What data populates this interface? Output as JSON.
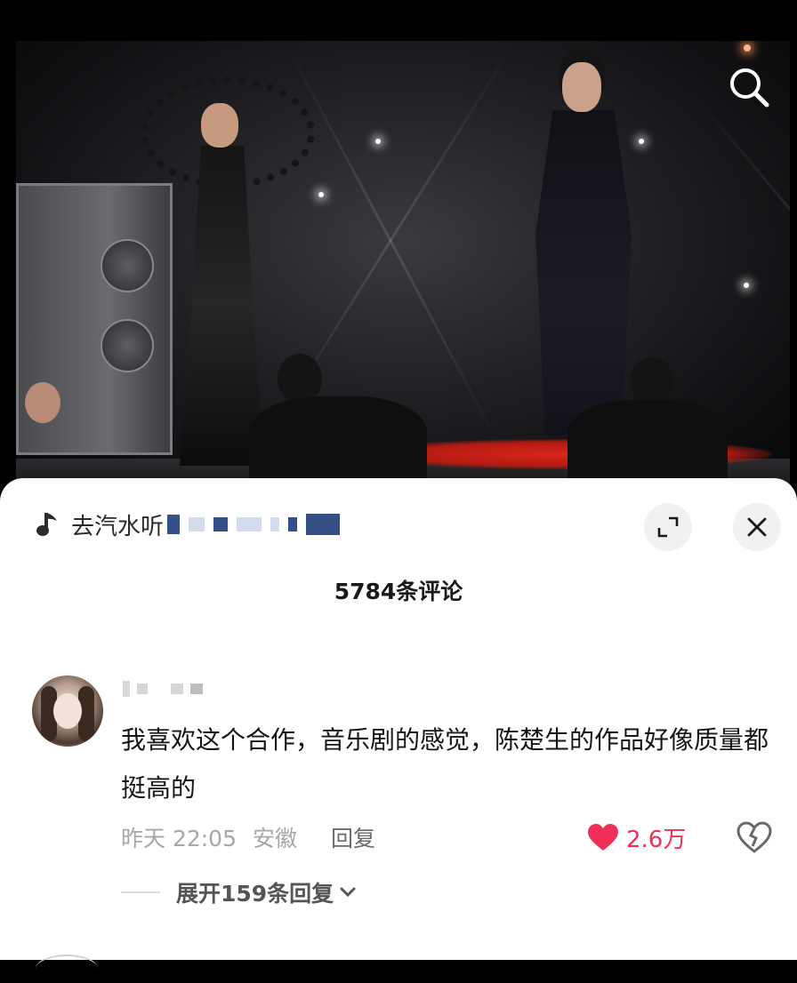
{
  "video": {
    "search_icon": "search-icon"
  },
  "sheet": {
    "music_prefix": "去汽水听",
    "comment_count": "5784条评论",
    "expand_icon": "expand-icon",
    "close_icon": "close-icon",
    "comment": {
      "text": "我喜欢这个合作，音乐剧的感觉，陈楚生的作品好像质量都挺高的",
      "time": "昨天 22:05",
      "location": "安徽",
      "reply_label": "回复",
      "likes": "2.6万",
      "expand_replies": "展开159条回复"
    },
    "colors": {
      "like_red": "#ef2f55",
      "sheet_bg": "#ffffff",
      "muted_text": "#a7a7ab"
    }
  }
}
